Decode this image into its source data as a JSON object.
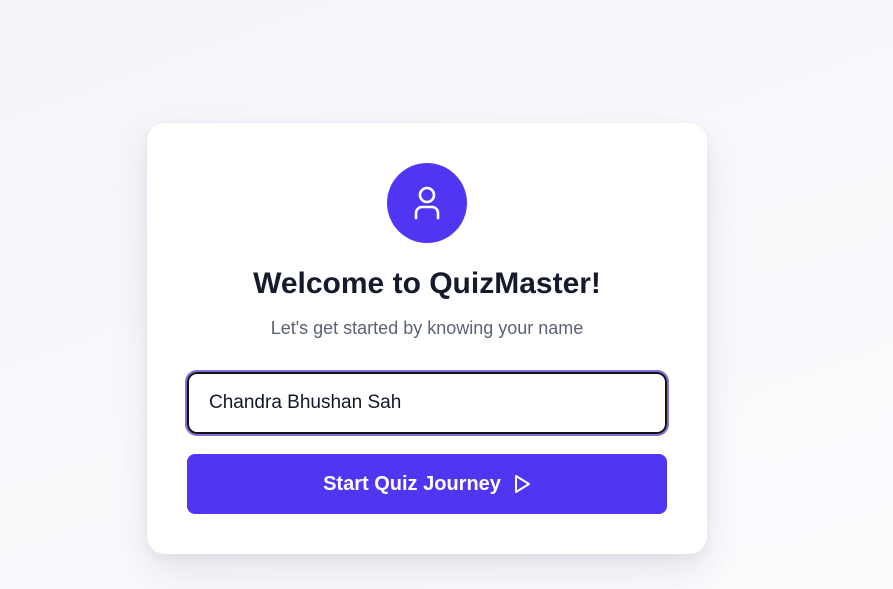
{
  "welcome": {
    "title": "Welcome to QuizMaster!",
    "subtitle": "Let's get started by knowing your name",
    "avatar_icon": "user-icon",
    "name_input_value": "Chandra Bhushan Sah",
    "start_button_label": "Start Quiz Journey",
    "start_button_icon": "play-icon"
  },
  "colors": {
    "accent": "#5035f3",
    "title_text": "#151a2d",
    "subtitle_text": "#5b6275",
    "background": "#f5f6fa"
  }
}
